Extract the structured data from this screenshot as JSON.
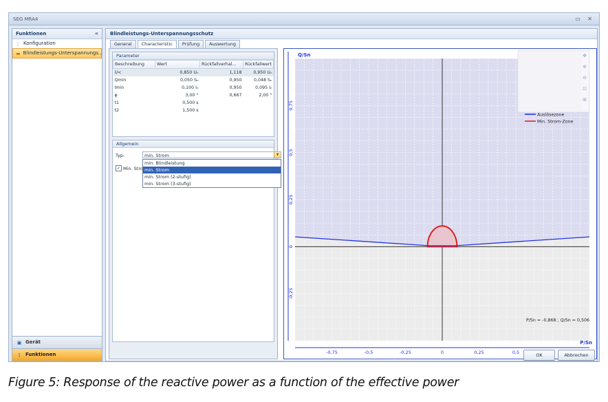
{
  "window": {
    "title": "SEG MRA4",
    "controls": "▭ ✕"
  },
  "left_panel": {
    "title": "Funktionen",
    "collapse": "«",
    "items": [
      {
        "label": "Konfiguration",
        "icon": "tree-icon"
      },
      {
        "label": "Blindleistungs-Unterspannungs...",
        "icon": "folder-icon"
      }
    ],
    "bottom": [
      {
        "label": "Gerät",
        "icon": "device-icon"
      },
      {
        "label": "Funktionen",
        "icon": "tree-icon"
      }
    ]
  },
  "main": {
    "title": "Blindleistungs-Unterspannungsschutz",
    "tabs": [
      "General",
      "Characteristic",
      "Prüfung",
      "Auswertung"
    ],
    "active_tab": "Characteristic"
  },
  "parameter": {
    "title": "Parameter",
    "columns": [
      "Beschreibung",
      "Wert",
      "Rückfallverhal...",
      "Rückfallwert"
    ],
    "rows": [
      [
        "U<",
        "0,850 Uₙ",
        "1,118",
        "0,950 Uₙ"
      ],
      [
        "Qmin",
        "0,050 Sₙ",
        "0,950",
        "0,048 Sₙ"
      ],
      [
        "Imin",
        "0,100 Iₙ",
        "0,950",
        "0,095 Iₙ"
      ],
      [
        "φ",
        "3,00 °",
        "0,667",
        "2,00 °"
      ],
      [
        "t1",
        "0,500 s",
        "",
        ""
      ],
      [
        "t2",
        "1,500 s",
        "",
        ""
      ]
    ]
  },
  "allgemein": {
    "title": "Allgemein",
    "typ_label": "Typ:",
    "typ_value": "min. Strom",
    "options": [
      "min. Blindleistung",
      "min. Strom",
      "min. Strom (2-stufig)",
      "min. Strom (3-stufig)"
    ],
    "selected_option": "min. Strom",
    "checkbox_label": "Min. Strom",
    "checkbox_checked": "✓"
  },
  "chart_data": {
    "type": "line",
    "ylabel": "Q/Sn",
    "xlabel": "P/Sn",
    "xlim": [
      -1,
      1
    ],
    "ylim": [
      -0.5,
      1
    ],
    "x_ticks": [
      -0.75,
      -0.5,
      -0.25,
      0,
      0.25,
      0.5
    ],
    "x_tick_labels": [
      "-0,75",
      "-0,5",
      "-0,25",
      "0",
      "0,25",
      "0,5"
    ],
    "y_ticks": [
      -0.25,
      0,
      0.25,
      0.5,
      0.75
    ],
    "y_tick_labels": [
      "-0,25",
      "0",
      "0,25",
      "0,5",
      "0,75"
    ],
    "grid": true,
    "legend_placement": "top-right",
    "series": [
      {
        "name": "Auslösezone",
        "color": "#2233dd",
        "x": [
          -1,
          -0.087,
          0.087,
          1
        ],
        "y": [
          0.052,
          0.005,
          0.005,
          0.052
        ]
      },
      {
        "name": "Min. Strom-Zone",
        "color": "#e02020",
        "shape": "semicircle",
        "radius": 0.1
      }
    ],
    "zone_fill": "#d9d9f2",
    "readout": "P/Sn = -0,868 ; Q/Sn = 0,506"
  },
  "zoom_tools": [
    "pan-icon",
    "zoom-in-icon",
    "zoom-out-icon",
    "zoom-fit-icon",
    "zoom-reset-icon"
  ],
  "buttons": {
    "ok": "OK",
    "cancel": "Abbrechen"
  },
  "caption": "Figure 5: Response of the reactive power as a function of the effective power"
}
